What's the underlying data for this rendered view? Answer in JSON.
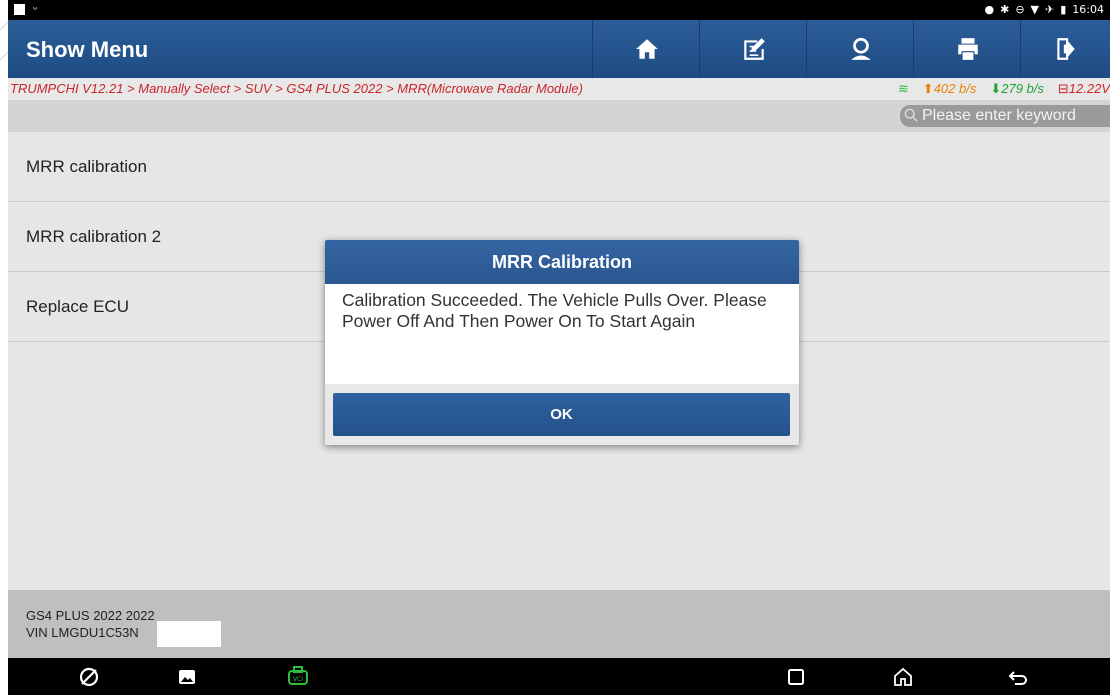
{
  "status_bar": {
    "time": "16:04",
    "left_icons": [
      "notification-square-icon",
      "usb-debug-icon"
    ],
    "right_icons": [
      "location-icon",
      "bluetooth-icon",
      "do-not-disturb-icon",
      "wifi-icon",
      "airplane-icon",
      "battery-icon"
    ]
  },
  "header": {
    "title": "Show Menu",
    "buttons": [
      "home-icon",
      "report-icon",
      "user-icon",
      "print-icon",
      "exit-icon"
    ]
  },
  "breadcrumb": {
    "path": "TRUMPCHI V12.21 > Manually Select > SUV > GS4 PLUS 2022 > MRR(Microwave Radar Module)",
    "upload": "402 b/s",
    "download": "279 b/s",
    "voltage": "12.22V"
  },
  "search": {
    "placeholder": "Please enter keyword"
  },
  "menu": {
    "items": [
      {
        "label": "MRR calibration"
      },
      {
        "label": "MRR calibration 2"
      },
      {
        "label": "Replace ECU"
      }
    ]
  },
  "footer": {
    "model": "GS4 PLUS 2022 2022",
    "vin_label": "VIN LMGDU1C53N"
  },
  "dialog": {
    "title": "MRR Calibration",
    "message": "Calibration Succeeded. The Vehicle Pulls Over. Please Power Off And Then Power On To Start Again",
    "ok_label": "OK"
  },
  "colors": {
    "header_blue": "#1e4c84",
    "breadcrumb_red": "#c8262a",
    "upload_orange": "#e8820c",
    "download_green": "#1ea232",
    "vci_green": "#2ebd3f"
  },
  "nav_bar": {
    "buttons": [
      "browser-icon",
      "gallery-icon",
      "vci-icon",
      "recents-icon",
      "home-icon",
      "back-icon"
    ]
  }
}
